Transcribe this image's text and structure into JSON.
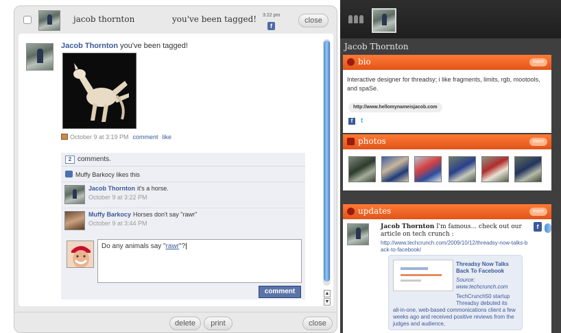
{
  "message": {
    "header": {
      "name": "jacob thornton",
      "status": "you've been tagged!",
      "time": "3:22 pm",
      "close_label": "close"
    },
    "post": {
      "author": "Jacob Thornton",
      "title_rest": " you've been tagged!",
      "timestamp": "October 9 at 3:19 PM",
      "comment_link": "comment",
      "like_link": "like"
    },
    "comments": {
      "count": "2",
      "count_label": "comments.",
      "likes": "Muffy Barkocy likes this",
      "items": [
        {
          "author": "Jacob Thornton",
          "text": "it's a horse.",
          "time": "October 9 at 3:22 PM"
        },
        {
          "author": "Muffy Barkocy",
          "text": "Horses don't say \"rawr\"",
          "time": "October 9 at 3:44 PM"
        }
      ],
      "reply_prefix": "Do any animals say \"",
      "reply_word": "rawr",
      "reply_suffix": "\"?",
      "submit_label": "comment"
    },
    "footer": {
      "delete_label": "delete",
      "print_label": "print",
      "close_label": "close"
    }
  },
  "panel": {
    "profile_name": "Jacob Thornton",
    "more_label": "more",
    "bio": {
      "title": "bio",
      "text": "Interactive designer for threadsy; i like fragments, limits, rgb, mootools, and spaSe.",
      "url": "http://www.hellomynameisjacob.com",
      "facebook_glyph": "f",
      "twitter_glyph": "t"
    },
    "photos": {
      "title": "photos",
      "count": 6
    },
    "updates": {
      "title": "updates",
      "author": "Jacob Thornton",
      "text": " I'm famous... check out our article on tech crunch :",
      "url": "http://www.techcrunch.com/2009/10/12/threadsy-now-talks-back-to-facebook/",
      "link_title": "Threadsy Now Talks Back To Facebook",
      "link_source": "Source: www.techcrunch.com",
      "link_desc_first": "TechCrunch50 startup Threadsy debuted its",
      "link_desc_rest": "all-in-one, web-based commonications client a few weeks ago and received positive reviews from the judges and audience,"
    }
  },
  "colors": {
    "facebook_blue": "#3b5998",
    "section_orange": "#e8601f",
    "panel_dark": "#3f3f3f",
    "comment_button": "#5b74a8"
  }
}
